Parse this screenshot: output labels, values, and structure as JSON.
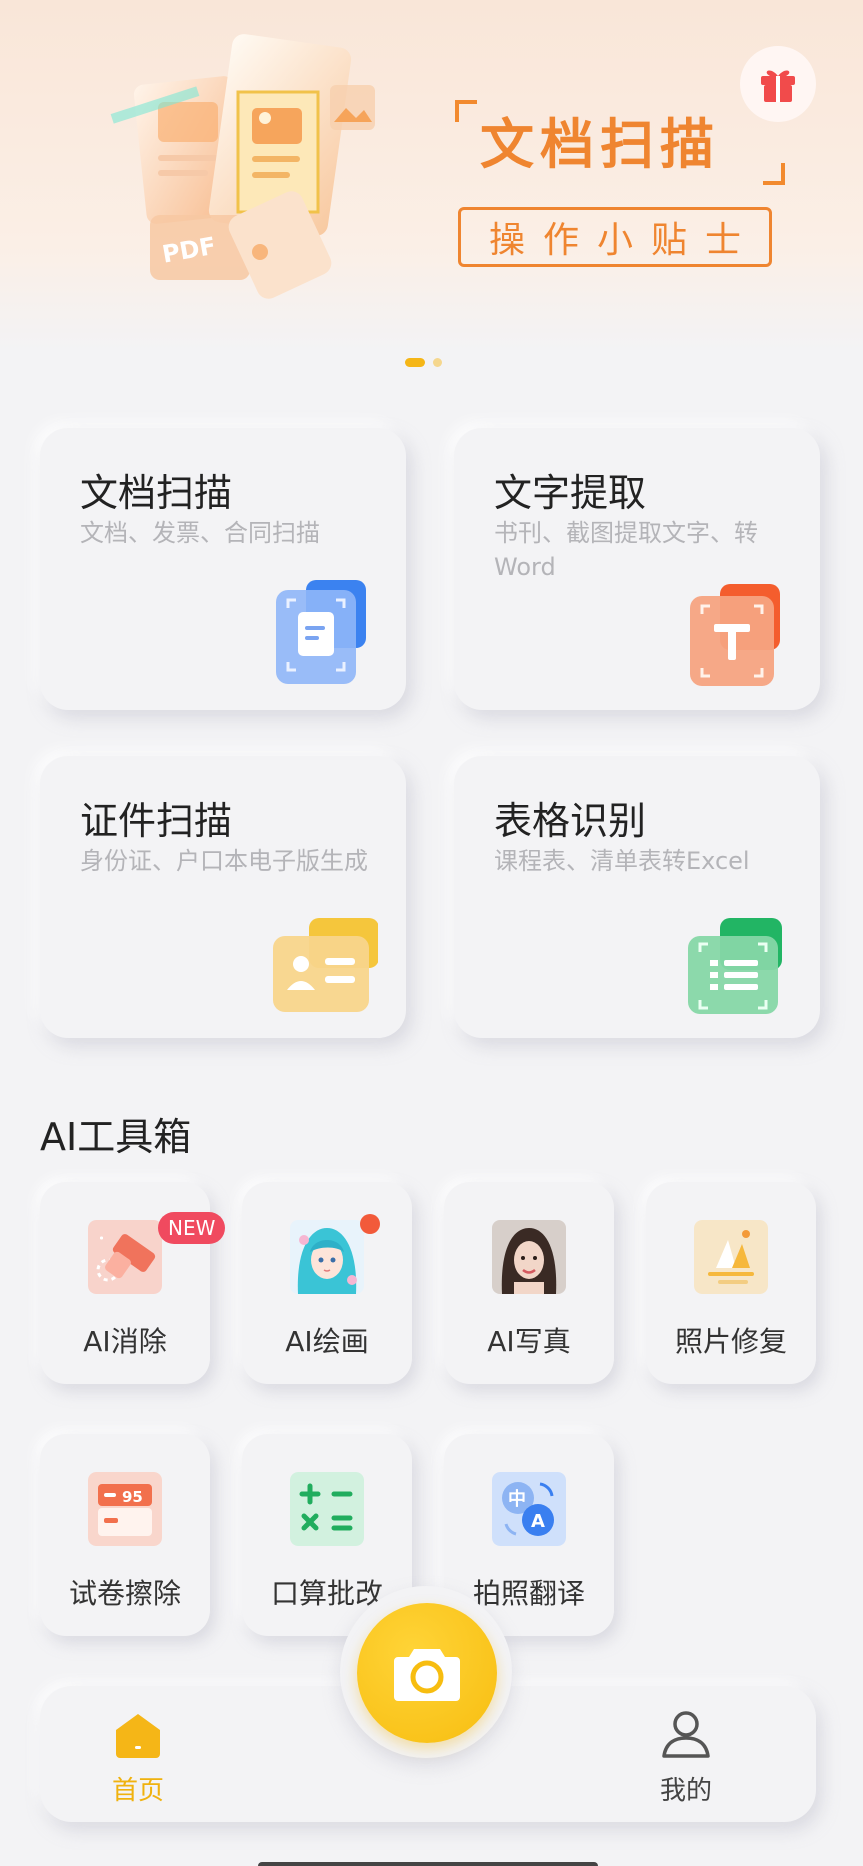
{
  "banner": {
    "title": "文档扫描",
    "subtitle": "操作小贴士",
    "art_text": "PDF",
    "icon": "gift-icon",
    "pages": 2,
    "active_page": 1
  },
  "cards": [
    {
      "title": "文档扫描",
      "desc": "文档、发票、合同扫描",
      "icon": "document-scan-icon"
    },
    {
      "title": "文字提取",
      "desc": "书刊、截图提取文字、转Word",
      "icon": "text-extract-icon"
    },
    {
      "title": "证件扫描",
      "desc": "身份证、户口本电子版生成",
      "icon": "id-card-icon"
    },
    {
      "title": "表格识别",
      "desc": "课程表、清单表转Excel",
      "icon": "table-recognition-icon"
    }
  ],
  "ai_toolbox": {
    "title": "AI工具箱",
    "tools": [
      {
        "label": "AI消除",
        "badge": "NEW",
        "icon": "eraser-icon"
      },
      {
        "label": "AI绘画",
        "icon": "anime-girl-icon"
      },
      {
        "label": "AI写真",
        "icon": "portrait-icon"
      },
      {
        "label": "照片修复",
        "icon": "photo-repair-icon"
      },
      {
        "label": "试卷擦除",
        "icon": "exam-erase-icon",
        "icon_text": "95"
      },
      {
        "label": "口算批改",
        "icon": "calculator-icon"
      },
      {
        "label": "拍照翻译",
        "icon": "translate-icon",
        "icon_text_a": "中",
        "icon_text_b": "A"
      }
    ]
  },
  "nav": {
    "home_label": "首页",
    "mine_label": "我的",
    "camera_icon": "camera-icon",
    "active": "首页"
  },
  "colors": {
    "accent": "#f5b617",
    "banner_orange": "#ef8530",
    "badge_red": "#f04a5f",
    "background": "#f3f3f5"
  }
}
